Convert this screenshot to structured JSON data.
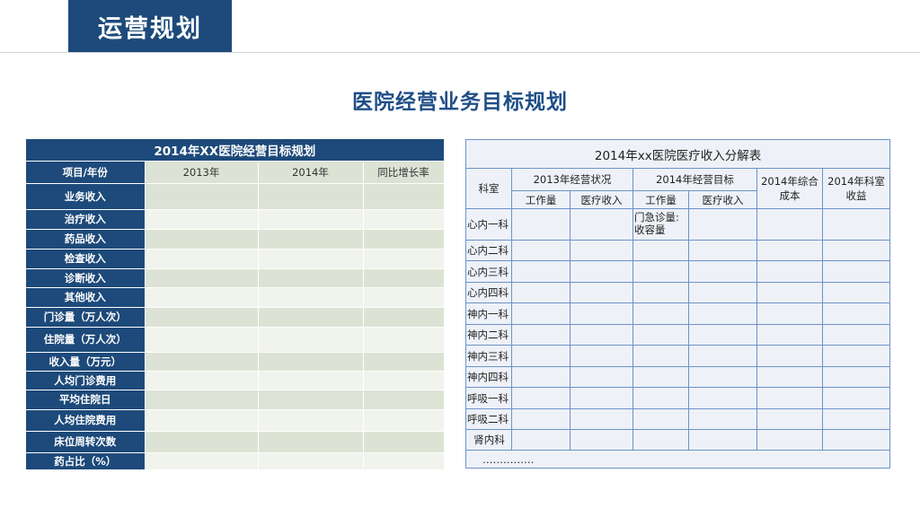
{
  "header": {
    "tab_label": "运营规划"
  },
  "main_title": "医院经营业务目标规划",
  "left_table": {
    "title": "2014年XX医院经营目标规划",
    "columns": [
      "项目/年份",
      "2013年",
      "2014年",
      "同比增长率"
    ],
    "rows": [
      "业务收入",
      "治疗收入",
      "药品收入",
      "检查收入",
      "诊断收入",
      "其他收入",
      "门诊量（万人次）",
      "住院量（万人次）",
      "收入量（万元）",
      "人均门诊费用",
      "平均住院日",
      "人均住院费用",
      "床位周转次数",
      "药占比（%）"
    ]
  },
  "right_table": {
    "title": "2014年xx医院医疗收入分解表",
    "col_dept": "科室",
    "group_2013": "2013年经营状况",
    "group_2014": "2014年经营目标",
    "col_cost": "2014年综合成本",
    "col_profit": "2014年科室收益",
    "sub_workload": "工作量",
    "sub_income": "医疗收入",
    "note_line1": "门急诊量:",
    "note_line2": "收容量",
    "rows": [
      "心内一科",
      "心内二科",
      "心内三科",
      "心内四科",
      "神内一科",
      "神内二科",
      "神内三科",
      "神内四科",
      "呼吸一科",
      "呼吸二科",
      "肾内科"
    ],
    "ellipsis": "……………"
  }
}
